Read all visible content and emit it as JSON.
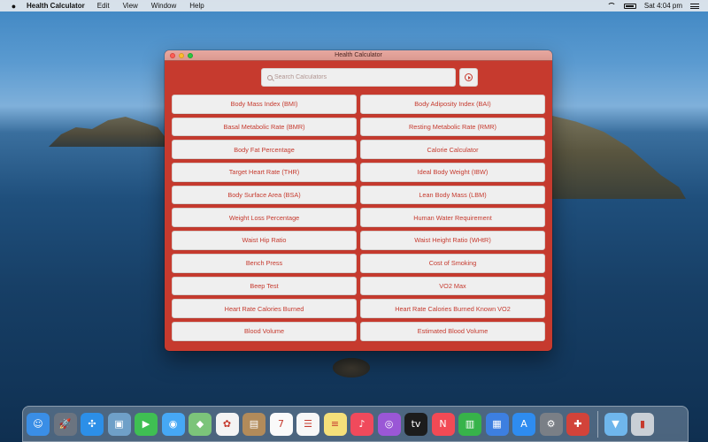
{
  "menubar": {
    "app_name": "Health Calculator",
    "menus": [
      "Edit",
      "View",
      "Window",
      "Help"
    ],
    "clock": "Sat 4:04 pm"
  },
  "window": {
    "title": "Health Calculator",
    "search_placeholder": "Search Calculators"
  },
  "calculators": [
    "Body Mass Index (BMI)",
    "Body Adiposity Index (BAI)",
    "Basal Metabolic Rate (BMR)",
    "Resting Metabolic Rate (RMR)",
    "Body Fat Percentage",
    "Calorie Calculator",
    "Target Heart Rate (THR)",
    "Ideal Body Weight (IBW)",
    "Body Surface Area (BSA)",
    "Lean Body Mass (LBM)",
    "Weight Loss Percentage",
    "Human Water Requirement",
    "Waist Hip Ratio",
    "Waist Height Ratio (WHtR)",
    "Bench Press",
    "Cost of Smoking",
    "Beep Test",
    "VO2 Max",
    "Heart Rate Calories Burned",
    "Heart Rate Calories Burned Known VO2",
    "Blood Volume",
    "Estimated Blood Volume"
  ],
  "colors": {
    "accent": "#c63a2e",
    "button_bg": "#efefef",
    "titlebar": "#e7a8a0"
  },
  "dock": [
    {
      "name": "finder-icon",
      "color": "#3a8ee6",
      "glyph": "☺"
    },
    {
      "name": "launchpad-icon",
      "color": "#6b7480",
      "glyph": "🚀"
    },
    {
      "name": "safari-icon",
      "color": "#2c8fe8",
      "glyph": "✣"
    },
    {
      "name": "preview-icon",
      "color": "#6fa0c8",
      "glyph": "▣"
    },
    {
      "name": "facetime-icon",
      "color": "#3fbf53",
      "glyph": "▶"
    },
    {
      "name": "messages-icon",
      "color": "#46a8f5",
      "glyph": "◉"
    },
    {
      "name": "maps-icon",
      "color": "#7cc47a",
      "glyph": "◆"
    },
    {
      "name": "photos-icon",
      "color": "#f4f4f4",
      "glyph": "✿"
    },
    {
      "name": "contacts-icon",
      "color": "#b28b5a",
      "glyph": "▤"
    },
    {
      "name": "calendar-icon",
      "color": "#fafafa",
      "glyph": "7"
    },
    {
      "name": "reminders-icon",
      "color": "#f7f7f7",
      "glyph": "☰"
    },
    {
      "name": "notes-icon",
      "color": "#f5e07a",
      "glyph": "≡"
    },
    {
      "name": "music-icon",
      "color": "#f04a5c",
      "glyph": "♪"
    },
    {
      "name": "podcasts-icon",
      "color": "#9a57d6",
      "glyph": "◎"
    },
    {
      "name": "tv-icon",
      "color": "#1c1c1c",
      "glyph": "tv"
    },
    {
      "name": "news-icon",
      "color": "#f24a55",
      "glyph": "N"
    },
    {
      "name": "numbers-icon",
      "color": "#37b34a",
      "glyph": "▥"
    },
    {
      "name": "keynote-icon",
      "color": "#3d7fe0",
      "glyph": "▦"
    },
    {
      "name": "app-store-icon",
      "color": "#2e8cf0",
      "glyph": "A"
    },
    {
      "name": "system-preferences-icon",
      "color": "#7a7f86",
      "glyph": "⚙"
    },
    {
      "name": "health-calculator-icon",
      "color": "#d2433a",
      "glyph": "✚"
    },
    {
      "name": "downloads-folder-icon",
      "color": "#6fb6ec",
      "glyph": "▼"
    },
    {
      "name": "trash-icon",
      "color": "#c9cfd6",
      "glyph": "▮"
    }
  ]
}
